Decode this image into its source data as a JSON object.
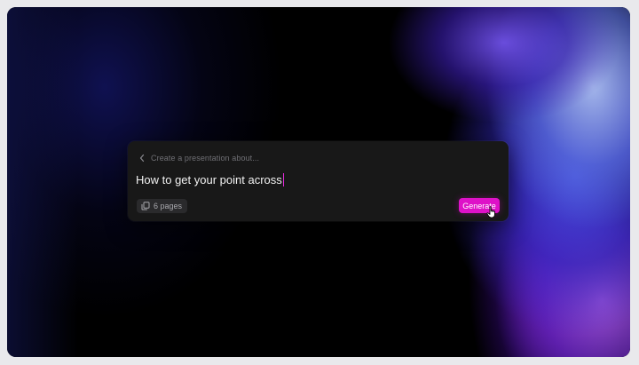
{
  "composer": {
    "hint": "Create a presentation about...",
    "prompt_value": "How to get your point across",
    "pages_label": "6 pages",
    "generate_label": "Generate"
  },
  "icons": {
    "back": "chevron-left-icon",
    "pages": "copy-pages-icon",
    "pointer": "hand-pointer-cursor"
  },
  "colors": {
    "accent": "#de12c8",
    "card_bg": "#181818",
    "caret": "#e02ad7"
  }
}
